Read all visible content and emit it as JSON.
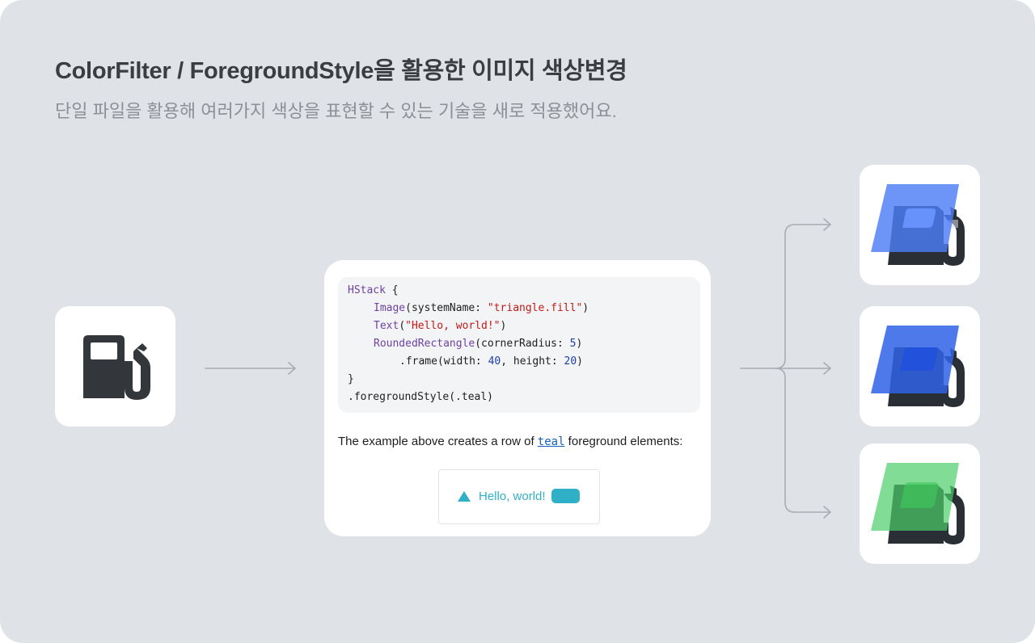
{
  "header": {
    "title": "ColorFilter / ForegroundStyle을 활용한 이미지 색상변경",
    "subtitle": "단일 파일을 활용해 여러가지 색상을 표현할 수 있는 기술을 새로 적용했어요."
  },
  "source_icon": {
    "icon": "fuel-pump-icon",
    "color": "#33363b"
  },
  "code_card": {
    "code": {
      "l1_kw": "HStack",
      "l1_rest": " {",
      "l2_kw": "Image",
      "l2_a": "(systemName: ",
      "l2_str": "\"triangle.fill\"",
      "l2_b": ")",
      "l3_kw": "Text",
      "l3_a": "(",
      "l3_str": "\"Hello, world!\"",
      "l3_b": ")",
      "l4_kw": "RoundedRectangle",
      "l4_a": "(cornerRadius: ",
      "l4_num": "5",
      "l4_b": ")",
      "l5_a": ".frame(width: ",
      "l5_num1": "40",
      "l5_b": ", height: ",
      "l5_num2": "20",
      "l5_c": ")",
      "l6": "}",
      "l7": ".foregroundStyle(.teal)"
    },
    "description": {
      "before": "The example above creates a row of ",
      "link": "teal",
      "after": " foreground elements:"
    },
    "preview": {
      "icon": "triangle-icon",
      "text": "Hello, world!",
      "color": "#30b0c7"
    }
  },
  "outputs": [
    {
      "icon": "fuel-pump-icon",
      "overlay_color": "#4d7ef7"
    },
    {
      "icon": "fuel-pump-icon",
      "overlay_color": "#2f62e6"
    },
    {
      "icon": "fuel-pump-icon",
      "overlay_color": "#4ccf68"
    }
  ]
}
